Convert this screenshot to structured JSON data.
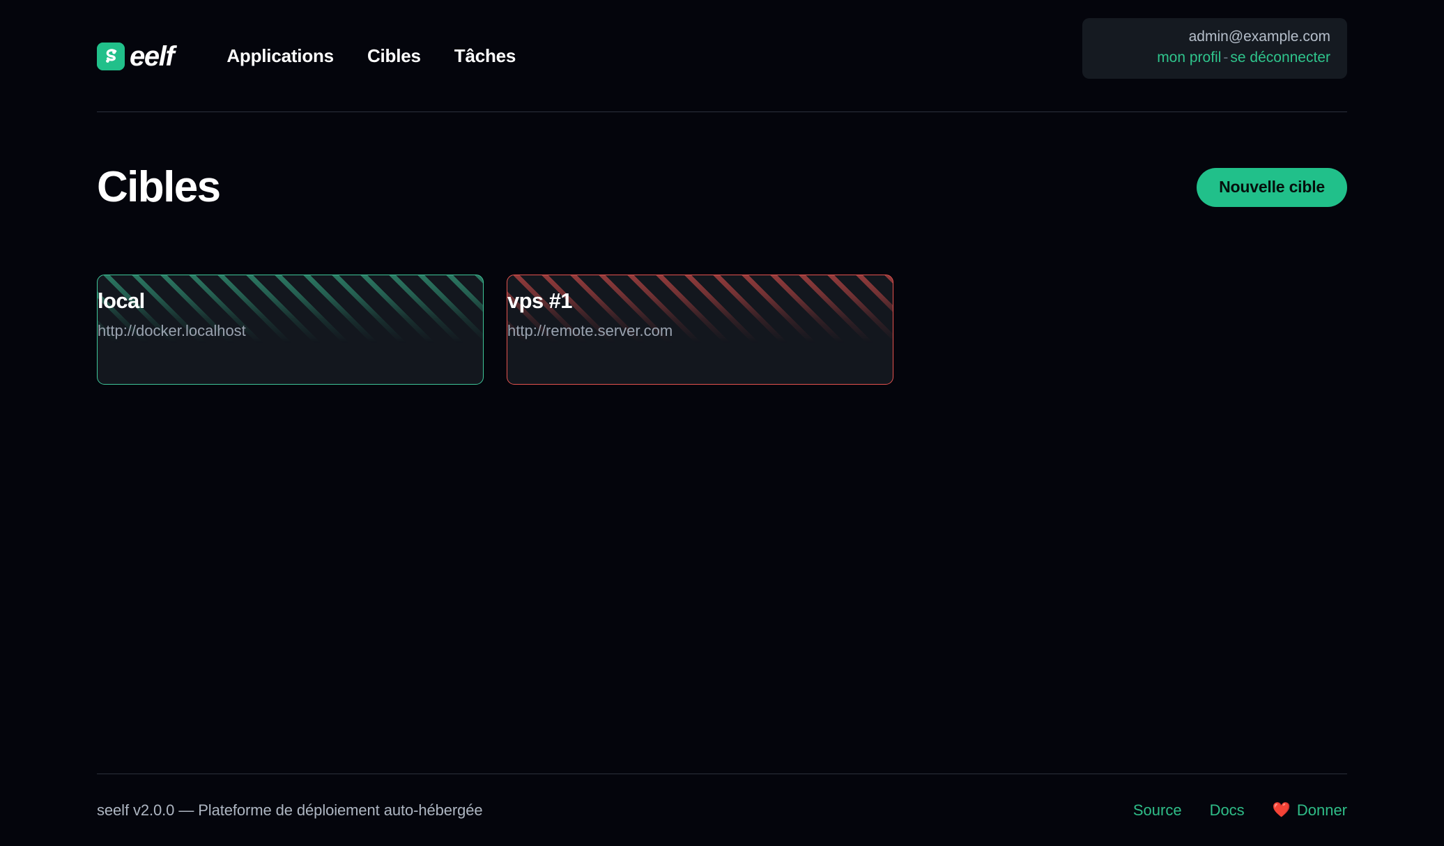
{
  "header": {
    "brand": {
      "mark_icon": "seelf-logo-icon",
      "text": "eelf",
      "full_name": "seelf",
      "mark_color": "#21c08a"
    },
    "nav": [
      {
        "label": "Applications"
      },
      {
        "label": "Cibles"
      },
      {
        "label": "Tâches"
      }
    ],
    "user": {
      "email": "admin@example.com",
      "profile_label": "mon profil",
      "separator": "-",
      "logout_label": "se déconnecter",
      "accent_color": "#2fc48c"
    }
  },
  "main": {
    "title": "Cibles",
    "new_target_label": "Nouvelle cible",
    "targets": [
      {
        "name": "local",
        "url": "http://docker.localhost",
        "status": "ok",
        "status_color": "#3fc79a"
      },
      {
        "name": "vps #1",
        "url": "http://remote.server.com",
        "status": "error",
        "status_color": "#e6534f"
      }
    ]
  },
  "footer": {
    "text": "seelf v2.0.0 — Plateforme de déploiement auto-hébergée",
    "links": [
      {
        "label": "Source"
      },
      {
        "label": "Docs"
      }
    ],
    "donate": {
      "heart_icon": "❤️",
      "label": "Donner"
    }
  }
}
